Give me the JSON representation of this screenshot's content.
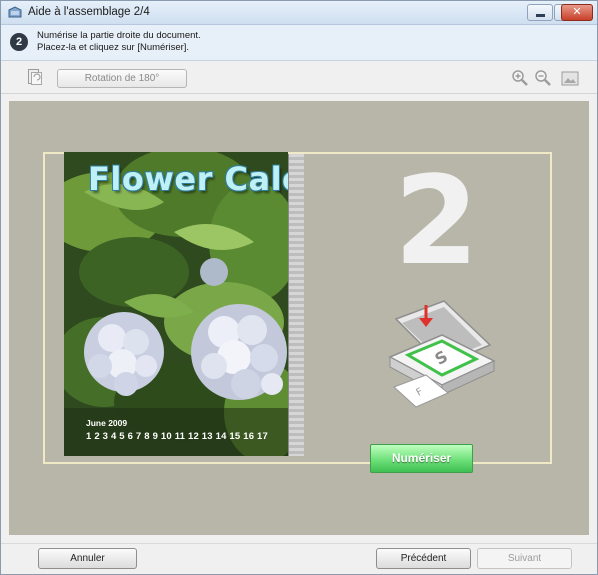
{
  "window": {
    "title": "Aide à l'assemblage 2/4",
    "controls": {
      "minimize": "minimize-icon",
      "maximize": "maximize-icon",
      "close": "close-icon"
    }
  },
  "instruction": {
    "step": "2",
    "line1": "Numérise la partie droite du document.",
    "line2": "Placez-la et cliquez sur [Numériser]."
  },
  "toolbar": {
    "rotate_label": "Rotation de 180°",
    "icons": [
      "page-rotate-icon",
      "zoom-in-icon",
      "zoom-out-icon",
      "full-screen-icon"
    ]
  },
  "preview": {
    "photo_title": "Flower Calen",
    "photo_month": "June 2009",
    "photo_days": "1 2 3 4 5 6 7 8 9 10 11 12 13 14 15 16 17",
    "step_number": "2",
    "scan_button": "Numériser"
  },
  "footer": {
    "cancel": "Annuler",
    "previous": "Précédent",
    "next": "Suivant"
  },
  "colors": {
    "preview_bg": "#b7b6a8",
    "frame_border": "#efeac5",
    "scan_button": "#6fe07a",
    "close_button": "#c8402a"
  }
}
